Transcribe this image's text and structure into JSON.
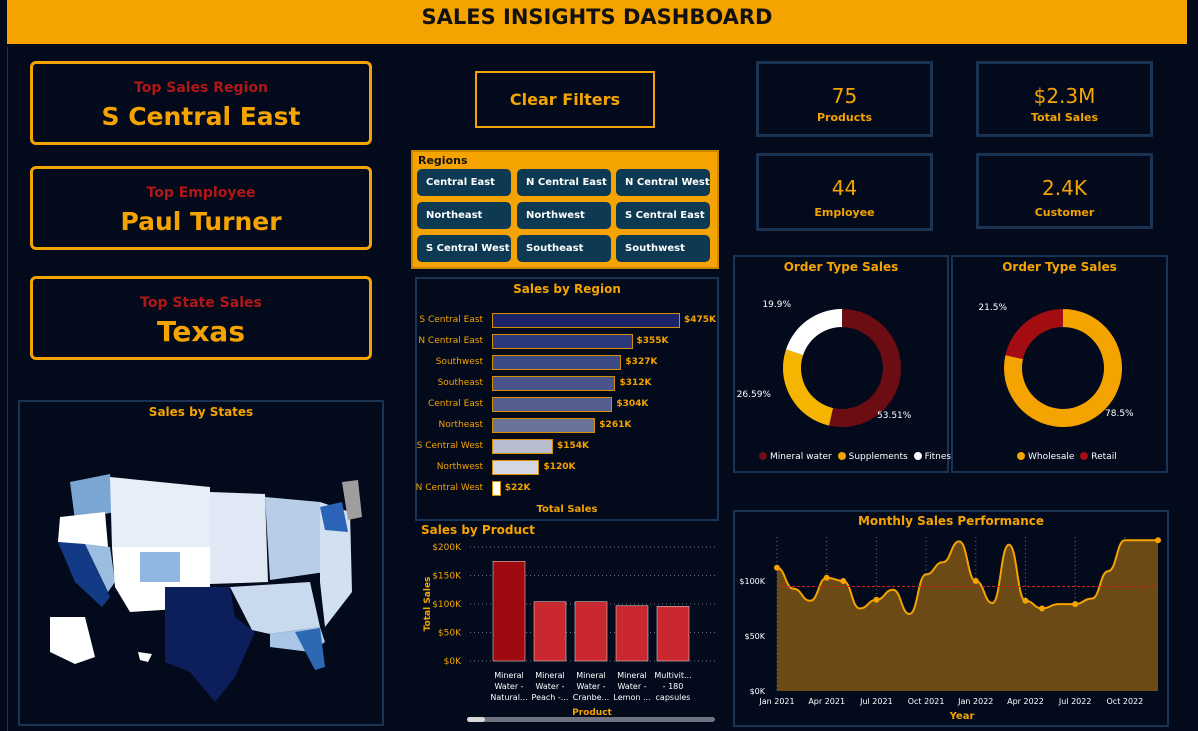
{
  "header": {
    "title": "SALES INSIGHTS DASHBOARD"
  },
  "top_cards": [
    {
      "label": "Top Sales Region",
      "value": "S Central East"
    },
    {
      "label": "Top Employee",
      "value": "Paul Turner"
    },
    {
      "label": "Top State Sales",
      "value": "Texas"
    }
  ],
  "clear_filters_label": "Clear Filters",
  "kpis": [
    {
      "value": "75",
      "label": "Products"
    },
    {
      "value": "$2.3M",
      "label": "Total Sales"
    },
    {
      "value": "44",
      "label": "Employee"
    },
    {
      "value": "2.4K",
      "label": "Customer"
    }
  ],
  "regions_slicer": {
    "title": "Regions",
    "items": [
      "Central East",
      "N Central East",
      "N Central West",
      "Northeast",
      "Northwest",
      "S Central East",
      "S Central West",
      "Southeast",
      "Southwest"
    ]
  },
  "sales_by_states": {
    "title": "Sales by States"
  },
  "colors": {
    "accent": "#f5a300",
    "dark_red": "#6b0d12",
    "red": "#a30d11",
    "navy": "#030a1c",
    "border": "#1b3352"
  },
  "order_type_1": {
    "title": "Order Type Sales",
    "legend": [
      "Mineral water",
      "Supplements",
      "Fitness"
    ],
    "labels": [
      "53.51%",
      "26.59%",
      "19.9%"
    ]
  },
  "order_type_2": {
    "title": "Order Type Sales",
    "legend": [
      "Wholesale",
      "Retail"
    ],
    "labels": [
      "78.5%",
      "21.5%"
    ]
  },
  "chart_data": [
    {
      "type": "bar",
      "orientation": "horizontal",
      "title": "Sales by Region",
      "xlabel": "Total Sales",
      "categories": [
        "S Central East",
        "N Central East",
        "Southwest",
        "Southeast",
        "Central East",
        "Northeast",
        "S Central West",
        "Northwest",
        "N Central West"
      ],
      "values": [
        475,
        355,
        327,
        312,
        304,
        261,
        154,
        120,
        22
      ],
      "value_labels": [
        "$475K",
        "$355K",
        "$327K",
        "$312K",
        "$304K",
        "$261K",
        "$154K",
        "$120K",
        "$22K"
      ],
      "unit": "$K"
    },
    {
      "type": "bar",
      "title": "Sales by Product",
      "xlabel": "Product",
      "ylabel": "Total Sales",
      "categories": [
        "Mineral Water - Natural...",
        "Mineral Water - Peach -...",
        "Mineral Water - Cranbe...",
        "Mineral Water - Lemon ...",
        "Multivit... - 180 capsules"
      ],
      "values": [
        175,
        104,
        104,
        97,
        96
      ],
      "unit": "$K",
      "ylim": [
        0,
        200
      ],
      "yticks": [
        "$0K",
        "$50K",
        "$100K",
        "$150K",
        "$200K"
      ]
    },
    {
      "type": "pie",
      "title": "Order Type Sales",
      "categories": [
        "Mineral water",
        "Supplements",
        "Fitness"
      ],
      "values": [
        53.51,
        26.59,
        19.9
      ]
    },
    {
      "type": "pie",
      "title": "Order Type Sales",
      "categories": [
        "Wholesale",
        "Retail"
      ],
      "values": [
        78.5,
        21.5
      ]
    },
    {
      "type": "area",
      "title": "Monthly Sales Performance",
      "xlabel": "Year",
      "x": [
        "2021-01",
        "2021-02",
        "2021-03",
        "2021-04",
        "2021-05",
        "2021-06",
        "2021-07",
        "2021-08",
        "2021-09",
        "2021-10",
        "2021-11",
        "2021-12",
        "2022-01",
        "2022-02",
        "2022-03",
        "2022-04",
        "2022-05",
        "2022-06",
        "2022-07",
        "2022-08",
        "2022-09",
        "2022-10",
        "2022-11",
        "2022-12"
      ],
      "values": [
        112,
        93,
        82,
        103,
        100,
        75,
        83,
        92,
        70,
        106,
        117,
        136,
        100,
        80,
        133,
        82,
        75,
        79,
        79,
        84,
        109,
        137,
        137,
        137
      ],
      "average": 95,
      "ylim": [
        0,
        140
      ],
      "yticks": [
        "$0K",
        "$50K",
        "$100K"
      ],
      "xticks": [
        "Jan 2021",
        "Apr 2021",
        "Jul 2021",
        "Oct 2021",
        "Jan 2022",
        "Apr 2022",
        "Jul 2022",
        "Oct 2022"
      ]
    }
  ]
}
